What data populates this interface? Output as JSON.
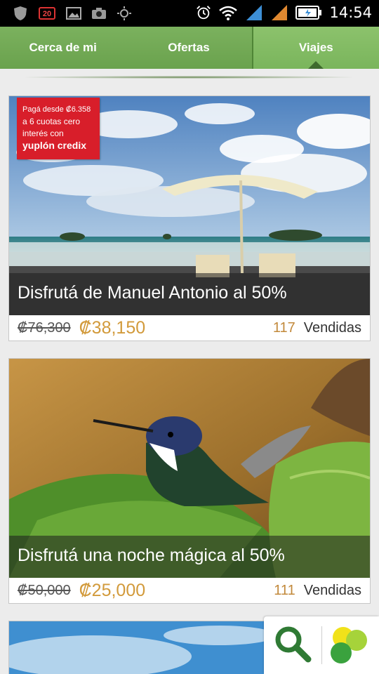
{
  "status_bar": {
    "left_icons": [
      "shield-icon",
      "notification-badge-icon",
      "image-icon",
      "camera-icon",
      "brightness-icon"
    ],
    "notification_badge": "20",
    "right_icons": [
      "alarm-icon",
      "wifi-icon",
      "signal-icon",
      "signal-alt-icon",
      "battery-charging-icon"
    ],
    "time": "14:54"
  },
  "tabs": [
    {
      "label": "Cerca de mi",
      "selected": false
    },
    {
      "label": "Ofertas",
      "selected": false
    },
    {
      "label": "Viajes",
      "selected": true
    }
  ],
  "deals": [
    {
      "title": "Disfrutá de Manuel Antonio al 50%",
      "old_price": "₡76,300",
      "new_price": "₡38,150",
      "sold_count": "117",
      "sold_label": "Vendidas",
      "promo": {
        "line1": "Pagá desde ₡6.358",
        "line2": "a 6 cuotas cero",
        "line3": "interés con",
        "line4": "yuplón credix"
      }
    },
    {
      "title": "Disfrutá una noche mágica al 50%",
      "old_price": "₡50,000",
      "new_price": "₡25,000",
      "sold_count": "111",
      "sold_label": "Vendidas"
    }
  ],
  "floating_buttons": [
    "search-icon",
    "yuplon-logo-icon"
  ],
  "colors": {
    "tab_green": "#6aa24d",
    "price_gold": "#d29a3b",
    "promo_red": "#d81e2a"
  }
}
